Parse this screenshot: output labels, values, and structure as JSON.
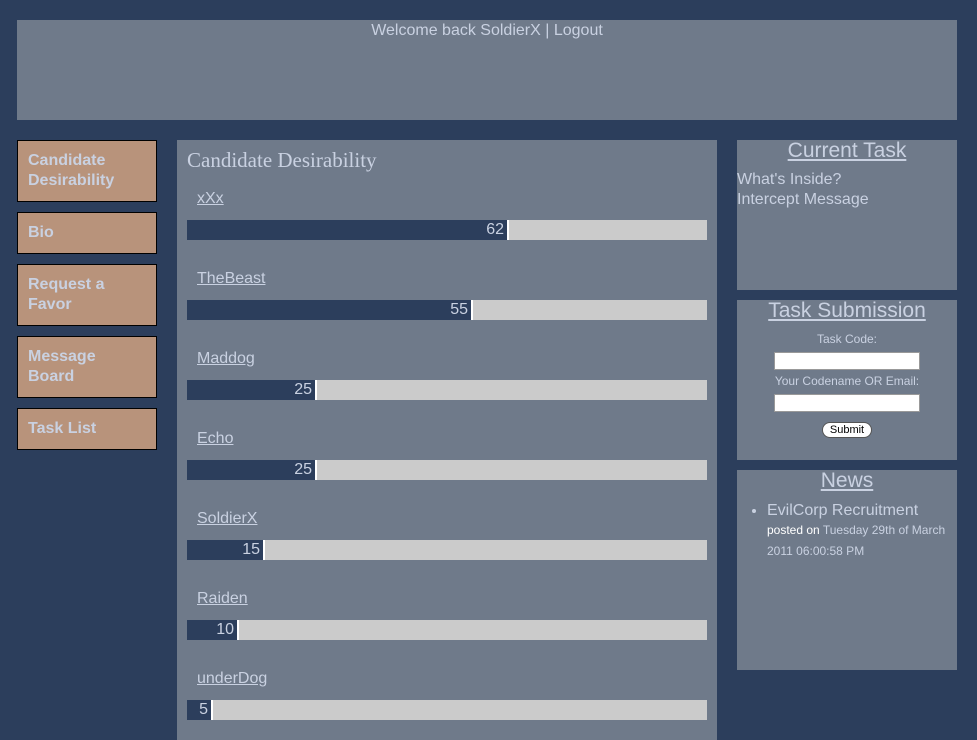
{
  "header": {
    "welcome_text": "Welcome back SoldierX",
    "separator": "|",
    "logout_label": "Logout"
  },
  "nav": {
    "items": [
      {
        "label": "Candidate Desirability"
      },
      {
        "label": "Bio"
      },
      {
        "label": "Request a Favor"
      },
      {
        "label": "Message Board"
      },
      {
        "label": "Task List"
      }
    ]
  },
  "main": {
    "title": "Candidate Desirability",
    "candidates": [
      {
        "name": "xXx",
        "score": 62
      },
      {
        "name": "TheBeast",
        "score": 55
      },
      {
        "name": "Maddog",
        "score": 25
      },
      {
        "name": "Echo",
        "score": 25
      },
      {
        "name": "SoldierX",
        "score": 15
      },
      {
        "name": "Raiden",
        "score": 10
      },
      {
        "name": "underDog",
        "score": 5
      }
    ],
    "max_score": 100
  },
  "current_task": {
    "title": "Current Task",
    "lines": [
      "What's Inside?",
      "Intercept Message"
    ]
  },
  "task_submission": {
    "title": "Task Submission",
    "task_code_label": "Task Code:",
    "task_code_value": "",
    "codename_label": "Your Codename OR Email:",
    "codename_value": "",
    "submit_label": "Submit"
  },
  "news": {
    "title": "News",
    "items": [
      {
        "title": "EvilCorp Recruitment",
        "posted_label": "posted on",
        "date": "Tuesday 29th of March 2011 06:00:58 PM"
      }
    ]
  },
  "colors": {
    "page_bg": "#2c3e5c",
    "panel_bg": "#6f7a8a",
    "nav_bg": "#b8937b",
    "bar_fill": "#2c3e5c",
    "bar_track": "#cbcbcb",
    "text": "#c9d1e1"
  }
}
